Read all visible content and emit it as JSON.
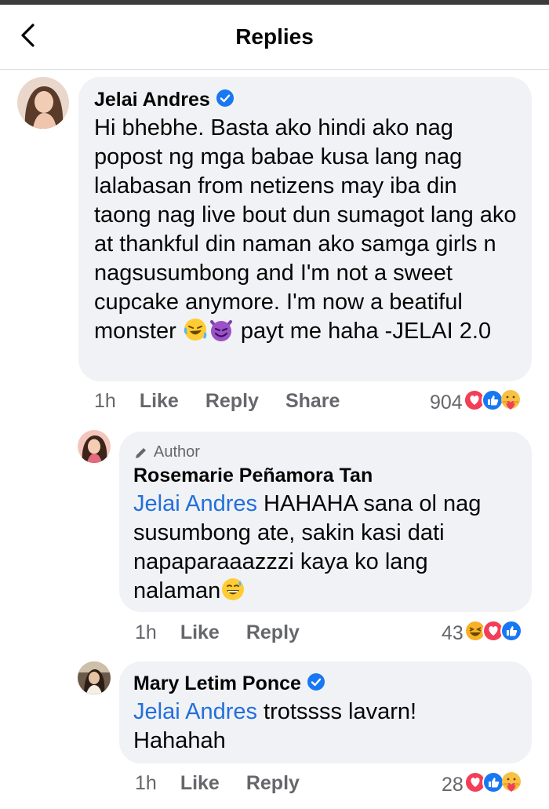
{
  "header": {
    "title": "Replies"
  },
  "comments": [
    {
      "name": "Jelai Andres",
      "verified": true,
      "text_part1": "Hi bhebhe. Basta ako hindi ako nag popost ng mga babae kusa lang nag lalabasan from netizens may iba din taong nag live bout dun sumagot lang ako at thankful din naman ako samga girls n nagsusumbong and I'm not a sweet cupcake anymore. I'm now a beatiful monster ",
      "text_part2": " payt me haha -JELAI 2.0",
      "emojis": [
        "rofl-emoji",
        "smiling-devil-emoji"
      ],
      "time": "1h",
      "actions": [
        "Like",
        "Reply",
        "Share"
      ],
      "reaction_count": "904",
      "reaction_icons": [
        "love-reaction-icon",
        "like-reaction-icon",
        "care-reaction-icon"
      ]
    },
    {
      "badge": "Author",
      "name": "Rosemarie Peñamora Tan",
      "mention": "Jelai Andres",
      "text": " HAHAHA sana ol nag susumbong ate, sakin kasi dati napaparaaazzzi kaya ko lang nalaman",
      "emoji": "grinning-sweat-emoji",
      "time": "1h",
      "actions": [
        "Like",
        "Reply"
      ],
      "reaction_count": "43",
      "reaction_icons": [
        "haha-reaction-icon",
        "love-reaction-icon",
        "like-reaction-icon"
      ]
    },
    {
      "name": "Mary Letim Ponce",
      "verified": true,
      "mention": "Jelai Andres",
      "text": " trotssss lavarn! Hahahah",
      "time": "1h",
      "actions": [
        "Like",
        "Reply"
      ],
      "reaction_count": "28",
      "reaction_icons": [
        "love-reaction-icon",
        "like-reaction-icon",
        "care-reaction-icon"
      ]
    }
  ],
  "colors": {
    "bubble": "#f0f2f5",
    "mention": "#216fdb",
    "verified": "#1877f2",
    "secondary_text": "#65676b",
    "love": "#f33e58",
    "like": "#1877f2",
    "haha": "#f7b125"
  }
}
